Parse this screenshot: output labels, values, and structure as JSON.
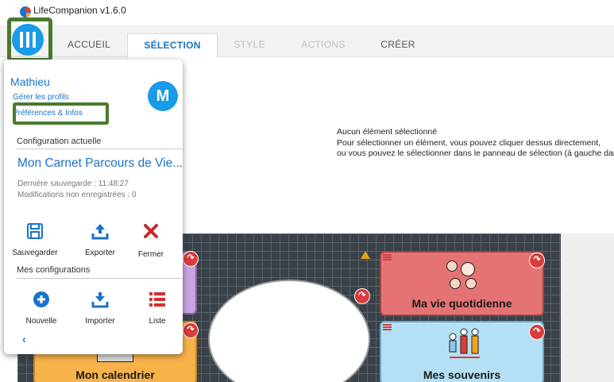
{
  "window": {
    "title": "LifeCompanion v1.6.0"
  },
  "tabs": [
    {
      "label": "ACCUEIL",
      "state": "normal"
    },
    {
      "label": "SÉLECTION",
      "state": "active"
    },
    {
      "label": "STYLE",
      "state": "disabled"
    },
    {
      "label": "ACTIONS",
      "state": "disabled"
    },
    {
      "label": "CRÉER",
      "state": "normal"
    }
  ],
  "selection_info": {
    "line1": "Aucun élément sélectionné",
    "line2": "Pour sélectionner un élément, vous pouvez cliquer dessus directement,",
    "line3": "ou vous pouvez le sélectionner dans le panneau de sélection (à gauche dans l'"
  },
  "profile_menu": {
    "user_name": "Mathieu",
    "avatar_letter": "M",
    "manage_profiles": "Gérer les profils",
    "preferences": "Préférences & Infos",
    "current_config_header": "Configuration actuelle",
    "config_name": "Mon Carnet Parcours de Vie...",
    "last_save": "Dernière sauvegarde : 11:48:27",
    "unsaved_changes": "Modifications non enregistrées : 0",
    "actions": [
      {
        "label": "Sauvegarder",
        "icon": "save-icon"
      },
      {
        "label": "Exporter",
        "icon": "export-icon"
      },
      {
        "label": "Fermer",
        "icon": "close-icon"
      }
    ],
    "my_configs_header": "Mes configurations",
    "config_actions": [
      {
        "label": "Nouvelle",
        "icon": "add-circle-icon"
      },
      {
        "label": "Importer",
        "icon": "import-icon"
      },
      {
        "label": "Liste",
        "icon": "list-icon"
      }
    ],
    "back_icon": "chevron-left-icon"
  },
  "grid_cells": [
    {
      "label": "Ma vie quotidienne",
      "color": "#e57373"
    },
    {
      "label": "Mes souvenirs",
      "color": "#b3e0f5"
    },
    {
      "label": "Mon calendrier",
      "color": "#f7b24a"
    }
  ],
  "colors": {
    "accent": "#1a9be8",
    "highlight": "#4a7a2c",
    "danger": "#d93c3c"
  }
}
